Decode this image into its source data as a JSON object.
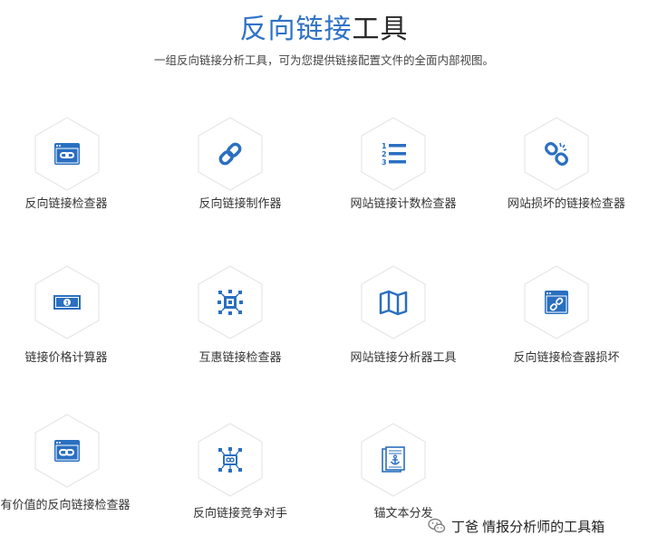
{
  "header": {
    "title_accent": "反向链接",
    "title_rest": "工具",
    "subtitle": "一组反向链接分析工具，可为您提供链接配置文件的全面内部视图。"
  },
  "tools": [
    {
      "label": "反向链接检查器",
      "icon": "browser-link-icon"
    },
    {
      "label": "反向链接制作器",
      "icon": "chain-link-icon"
    },
    {
      "label": "网站链接计数检查器",
      "icon": "numbered-list-icon"
    },
    {
      "label": "网站损坏的链接检查器",
      "icon": "broken-link-icon"
    },
    {
      "label": "链接价格计算器",
      "icon": "money-bill-icon"
    },
    {
      "label": "互惠链接检查器",
      "icon": "network-grid-icon"
    },
    {
      "label": "网站链接分析器工具",
      "icon": "map-icon"
    },
    {
      "label": "反向链接检查器损坏",
      "icon": "browser-broken-link-icon"
    },
    {
      "label": "有价值的反向链接检查器",
      "icon": "browser-chain-icon"
    },
    {
      "label": "反向链接竞争对手",
      "icon": "competitor-network-icon"
    },
    {
      "label": "锚文本分发",
      "icon": "anchor-document-icon"
    }
  ],
  "watermark": {
    "text": "丁爸 情报分析师的工具箱",
    "icon": "wechat-icon"
  },
  "colors": {
    "accent": "#2f72c6",
    "icon": "#2a6fc0",
    "hex_border": "#e6e6e6"
  }
}
